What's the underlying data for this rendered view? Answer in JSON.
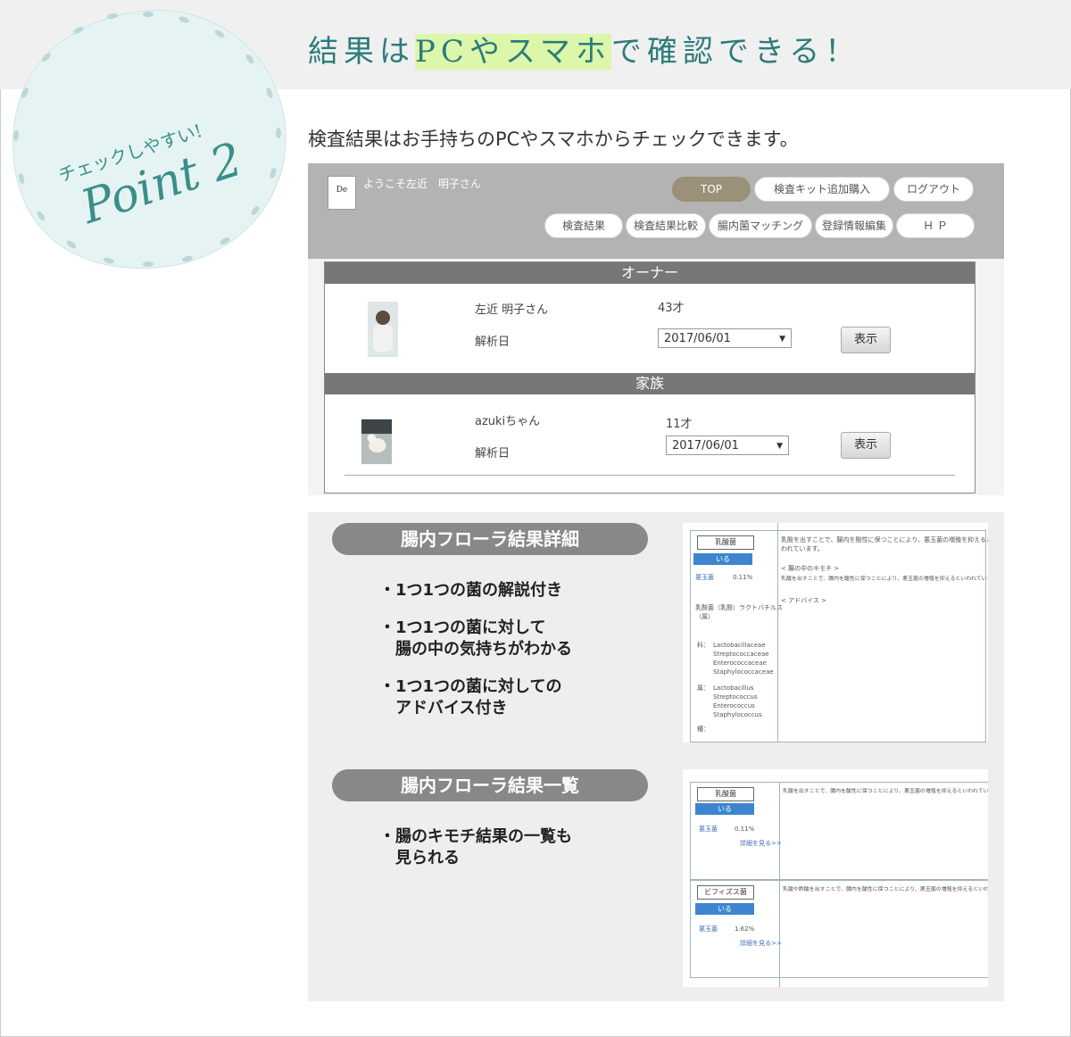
{
  "headline": {
    "before": "結果は",
    "highlight": "PCやスマホ",
    "after": "で確認できる！"
  },
  "badge": {
    "line1": "チェックしやすい!",
    "line2": "Point 2"
  },
  "intro": "検査結果はお手持ちのPCやスマホからチェックできます。",
  "app": {
    "logo": "De",
    "welcome": "ようこそ左近　明子さん",
    "nav_row1": [
      "TOP",
      "検査キット追加購入",
      "ログアウト"
    ],
    "nav_row2": [
      "検査結果",
      "検査結果比較",
      "腸内菌マッチング",
      "登録情報編集",
      "Ｈ Ｐ"
    ],
    "owner": {
      "section": "オーナー",
      "name": "左近 明子さん",
      "age": "43才",
      "date_label": "解析日",
      "date": "2017/06/01",
      "button": "表示"
    },
    "family": {
      "section": "家族",
      "name": "azukiちゃん",
      "age": "11才",
      "date_label": "解析日",
      "date": "2017/06/01",
      "button": "表示"
    }
  },
  "detail": {
    "title": "腸内フローラ結果詳細",
    "bullets": [
      "・1つ1つの菌の解説付き",
      "・1つ1つの菌に対して\n　腸の中の気持ちがわかる",
      "・1つ1つの菌に対しての\n　アドバイス付き"
    ],
    "shot": {
      "tag": "乳酸菌",
      "status": "いる",
      "label": "悪玉菌",
      "percent": "0.11%",
      "species": "乳酸菌（乳酸）ラクトバチルス\n（属）",
      "family_label": "科：",
      "families": "Lactobacillaceae\nStreptococcaceae\nEnterococcaceae\nStaphylococcaceae",
      "genus_label": "属：",
      "genera": "Lactobacillus\nStreptococcus\nEnterococcus\nStaphylococcus",
      "species_label": "種：",
      "desc": "乳酸を出すことで、腸内を酸性に保つことにより、悪玉菌の増殖を抑えるとい\nわれています。",
      "feeling_title": "< 腸の中のキモチ >",
      "feeling": "乳酸を出すことで、腸内を酸性に保つことにより、悪玉菌の増殖を抑えるといわれています。",
      "advice_title": "< アドバイス >"
    }
  },
  "list": {
    "title": "腸内フローラ結果一覧",
    "bullets": [
      "・腸のキモチ結果の一覧も\n　見られる"
    ],
    "items": [
      {
        "tag": "乳酸菌",
        "status": "いる",
        "label": "悪玉菌",
        "percent": "0.11%",
        "more": "詳細を見る>>",
        "desc": "乳酸を出すことで、腸内を酸性に保つことにより、悪玉菌の増殖を抑えるといわれています。"
      },
      {
        "tag": "ビフィズス菌",
        "status": "いる",
        "label": "悪玉菌",
        "percent": "1.62%",
        "more": "詳細を見る>>",
        "desc": "乳酸や酢酸を出すことで、腸内を酸性に保つことにより、悪玉菌の増殖を抑えるといわれています。"
      }
    ]
  },
  "colors": {
    "accent": "#2c7c7c",
    "highlight": "#dcf7a9",
    "nav_active": "#9b9078",
    "section_bar": "#777777",
    "pill_title": "#888888"
  }
}
